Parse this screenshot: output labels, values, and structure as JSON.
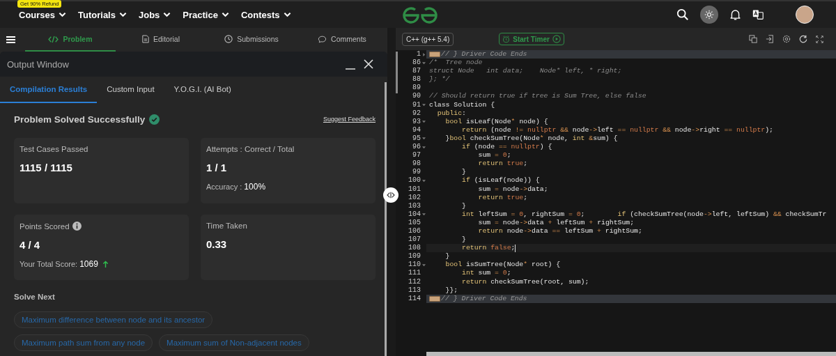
{
  "nav": {
    "items": [
      {
        "label": "Courses",
        "badge": "Get 90% Refund"
      },
      {
        "label": "Tutorials"
      },
      {
        "label": "Jobs"
      },
      {
        "label": "Practice"
      },
      {
        "label": "Contests"
      }
    ]
  },
  "problem_tabs": [
    {
      "label": "Problem",
      "selected": true
    },
    {
      "label": "Editorial",
      "selected": false
    },
    {
      "label": "Submissions",
      "selected": false
    },
    {
      "label": "Comments",
      "selected": false
    }
  ],
  "output_window": {
    "title": "Output Window",
    "tabs": [
      {
        "label": "Compilation Results",
        "selected": true
      },
      {
        "label": "Custom Input",
        "selected": false
      },
      {
        "label": "Y.O.G.I. (AI Bot)",
        "selected": false
      }
    ],
    "result_title": "Problem Solved Successfully",
    "feedback_link": "Suggest Feedback",
    "cards": [
      {
        "label": "Test Cases Passed",
        "value": "1115 / 1115",
        "info": false
      },
      {
        "label": "Attempts : Correct / Total",
        "value": "1 / 1",
        "sub_label": "Accuracy :",
        "sub_value": "100%",
        "info": false
      },
      {
        "label": "Points Scored",
        "value": "4 / 4",
        "sub_label": "Your Total Score:",
        "sub_value": "1069",
        "trend_up": true,
        "info": true
      },
      {
        "label": "Time Taken",
        "value": "0.33",
        "info": false
      }
    ],
    "solve_next": {
      "title": "Solve Next",
      "items": [
        "Maximum difference between node and its ancestor",
        "Maximum path sum from any node",
        "Maximum sum of Non-adjacent nodes"
      ]
    }
  },
  "editor": {
    "language": "C++ (g++ 5.4)",
    "timer_button": "Start Timer",
    "lines": [
      {
        "number": "1",
        "foldable": true,
        "collapsed": true,
        "folded_marker": true,
        "highlighted": true,
        "active": false,
        "segments": [
          {
            "kind": "comment",
            "text": "// } Driver Code Ends"
          }
        ]
      },
      {
        "number": "86",
        "foldable": true,
        "collapsed": false,
        "folded_marker": false,
        "highlighted": false,
        "active": false,
        "segments": [
          {
            "kind": "comment",
            "text": "/*  Tree node"
          }
        ]
      },
      {
        "number": "87",
        "foldable": false,
        "collapsed": false,
        "folded_marker": false,
        "highlighted": false,
        "active": false,
        "segments": [
          {
            "kind": "comment",
            "text": "struct Node   int data;    Node* left, * right;"
          }
        ]
      },
      {
        "number": "88",
        "foldable": false,
        "collapsed": false,
        "folded_marker": false,
        "highlighted": false,
        "active": false,
        "segments": [
          {
            "kind": "comment",
            "text": "}; */"
          }
        ]
      },
      {
        "number": "89",
        "foldable": false,
        "collapsed": false,
        "folded_marker": false,
        "highlighted": false,
        "active": false
      },
      {
        "number": "90",
        "foldable": false,
        "collapsed": false,
        "folded_marker": false,
        "highlighted": false,
        "active": false,
        "segments": [
          {
            "kind": "comment",
            "text": "// Should return true if tree is Sum Tree, else false"
          }
        ]
      },
      {
        "number": "91",
        "foldable": true,
        "collapsed": false,
        "folded_marker": false,
        "highlighted": false,
        "active": false,
        "segments": [
          {
            "kind": "plain",
            "text": "class Solution {"
          }
        ]
      },
      {
        "number": "92",
        "foldable": false,
        "collapsed": false,
        "folded_marker": false,
        "highlighted": false,
        "active": false,
        "segments": [
          {
            "kind": "keyword",
            "text": "  public"
          },
          {
            "kind": "plain",
            "text": ":"
          }
        ]
      },
      {
        "number": "93",
        "foldable": true,
        "collapsed": false,
        "folded_marker": false,
        "highlighted": false,
        "active": false,
        "segments": [
          {
            "kind": "keyword",
            "text": "    bool"
          },
          {
            "kind": "plain",
            "text": " isLeaf(Node"
          },
          {
            "kind": "operator",
            "text": "*"
          },
          {
            "kind": "plain",
            "text": " node) {"
          }
        ]
      },
      {
        "number": "94",
        "foldable": false,
        "collapsed": false,
        "folded_marker": false,
        "highlighted": false,
        "active": false,
        "segments": [
          {
            "kind": "keyword",
            "text": "        return"
          },
          {
            "kind": "plain",
            "text": " (node "
          },
          {
            "kind": "operator",
            "text": "!="
          },
          {
            "kind": "literal",
            "text": " nullptr"
          },
          {
            "kind": "operator",
            "text": " &&"
          },
          {
            "kind": "plain",
            "text": " node"
          },
          {
            "kind": "operator",
            "text": "->"
          },
          {
            "kind": "plain",
            "text": "left "
          },
          {
            "kind": "operator",
            "text": "=="
          },
          {
            "kind": "literal",
            "text": " nullptr"
          },
          {
            "kind": "operator",
            "text": " &&"
          },
          {
            "kind": "plain",
            "text": " node"
          },
          {
            "kind": "operator",
            "text": "->"
          },
          {
            "kind": "plain",
            "text": "right "
          },
          {
            "kind": "operator",
            "text": "=="
          },
          {
            "kind": "literal",
            "text": " nullptr"
          },
          {
            "kind": "plain",
            "text": ");"
          }
        ]
      },
      {
        "number": "95",
        "foldable": true,
        "collapsed": false,
        "folded_marker": false,
        "highlighted": false,
        "active": false,
        "segments": [
          {
            "kind": "plain",
            "text": "    }"
          },
          {
            "kind": "keyword",
            "text": "bool"
          },
          {
            "kind": "plain",
            "text": " checkSumTree(Node"
          },
          {
            "kind": "operator",
            "text": "*"
          },
          {
            "kind": "plain",
            "text": " node, "
          },
          {
            "kind": "keyword",
            "text": "int"
          },
          {
            "kind": "operator",
            "text": " &"
          },
          {
            "kind": "plain",
            "text": "sum) {"
          }
        ]
      },
      {
        "number": "96",
        "foldable": true,
        "collapsed": false,
        "folded_marker": false,
        "highlighted": false,
        "active": false,
        "segments": [
          {
            "kind": "keyword",
            "text": "        if"
          },
          {
            "kind": "plain",
            "text": " (node "
          },
          {
            "kind": "operator",
            "text": "=="
          },
          {
            "kind": "literal",
            "text": " nullptr"
          },
          {
            "kind": "plain",
            "text": ") {"
          }
        ]
      },
      {
        "number": "97",
        "foldable": false,
        "collapsed": false,
        "folded_marker": false,
        "highlighted": false,
        "active": false,
        "segments": [
          {
            "kind": "plain",
            "text": "            sum "
          },
          {
            "kind": "operator",
            "text": "="
          },
          {
            "kind": "literal",
            "text": " 0"
          },
          {
            "kind": "plain",
            "text": ";"
          }
        ]
      },
      {
        "number": "98",
        "foldable": false,
        "collapsed": false,
        "folded_marker": false,
        "highlighted": false,
        "active": false,
        "segments": [
          {
            "kind": "keyword",
            "text": "            return"
          },
          {
            "kind": "literal",
            "text": " true"
          },
          {
            "kind": "plain",
            "text": ";"
          }
        ]
      },
      {
        "number": "99",
        "foldable": false,
        "collapsed": false,
        "folded_marker": false,
        "highlighted": false,
        "active": false,
        "segments": [
          {
            "kind": "plain",
            "text": "        }"
          }
        ]
      },
      {
        "number": "100",
        "foldable": true,
        "collapsed": false,
        "folded_marker": false,
        "highlighted": false,
        "active": false,
        "segments": [
          {
            "kind": "keyword",
            "text": "        if"
          },
          {
            "kind": "plain",
            "text": " (isLeaf(node)) {"
          }
        ]
      },
      {
        "number": "101",
        "foldable": false,
        "collapsed": false,
        "folded_marker": false,
        "highlighted": false,
        "active": false,
        "segments": [
          {
            "kind": "plain",
            "text": "            sum "
          },
          {
            "kind": "operator",
            "text": "="
          },
          {
            "kind": "plain",
            "text": " node"
          },
          {
            "kind": "operator",
            "text": "->"
          },
          {
            "kind": "plain",
            "text": "data;"
          }
        ]
      },
      {
        "number": "102",
        "foldable": false,
        "collapsed": false,
        "folded_marker": false,
        "highlighted": false,
        "active": false,
        "segments": [
          {
            "kind": "keyword",
            "text": "            return"
          },
          {
            "kind": "literal",
            "text": " true"
          },
          {
            "kind": "plain",
            "text": ";"
          }
        ]
      },
      {
        "number": "103",
        "foldable": false,
        "collapsed": false,
        "folded_marker": false,
        "highlighted": false,
        "active": false,
        "segments": [
          {
            "kind": "plain",
            "text": "        }"
          }
        ]
      },
      {
        "number": "104",
        "foldable": true,
        "collapsed": false,
        "folded_marker": false,
        "highlighted": false,
        "active": false,
        "segments": [
          {
            "kind": "keyword",
            "text": "        int"
          },
          {
            "kind": "plain",
            "text": " leftSum "
          },
          {
            "kind": "operator",
            "text": "="
          },
          {
            "kind": "literal",
            "text": " 0"
          },
          {
            "kind": "plain",
            "text": ", rightSum "
          },
          {
            "kind": "operator",
            "text": "="
          },
          {
            "kind": "literal",
            "text": " 0"
          },
          {
            "kind": "plain",
            "text": ";"
          },
          {
            "kind": "keyword",
            "text": "        if"
          },
          {
            "kind": "plain",
            "text": " (checkSumTree(node"
          },
          {
            "kind": "operator",
            "text": "->"
          },
          {
            "kind": "plain",
            "text": "left, leftSum) "
          },
          {
            "kind": "operator",
            "text": "&&"
          },
          {
            "kind": "plain",
            "text": " checkSumTr"
          }
        ]
      },
      {
        "number": "105",
        "foldable": false,
        "collapsed": false,
        "folded_marker": false,
        "highlighted": false,
        "active": false,
        "segments": [
          {
            "kind": "plain",
            "text": "            sum "
          },
          {
            "kind": "operator",
            "text": "="
          },
          {
            "kind": "plain",
            "text": " node"
          },
          {
            "kind": "operator",
            "text": "->"
          },
          {
            "kind": "plain",
            "text": "data "
          },
          {
            "kind": "operator",
            "text": "+"
          },
          {
            "kind": "plain",
            "text": " leftSum "
          },
          {
            "kind": "operator",
            "text": "+"
          },
          {
            "kind": "plain",
            "text": " rightSum;"
          }
        ]
      },
      {
        "number": "106",
        "foldable": false,
        "collapsed": false,
        "folded_marker": false,
        "highlighted": false,
        "active": false,
        "segments": [
          {
            "kind": "keyword",
            "text": "            return"
          },
          {
            "kind": "plain",
            "text": " node"
          },
          {
            "kind": "operator",
            "text": "->"
          },
          {
            "kind": "plain",
            "text": "data "
          },
          {
            "kind": "operator",
            "text": "=="
          },
          {
            "kind": "plain",
            "text": " leftSum "
          },
          {
            "kind": "operator",
            "text": "+"
          },
          {
            "kind": "plain",
            "text": " rightSum;"
          }
        ]
      },
      {
        "number": "107",
        "foldable": false,
        "collapsed": false,
        "folded_marker": false,
        "highlighted": false,
        "active": false,
        "segments": [
          {
            "kind": "plain",
            "text": "        }"
          }
        ]
      },
      {
        "number": "108",
        "foldable": false,
        "collapsed": false,
        "folded_marker": false,
        "highlighted": false,
        "active": true,
        "segments": [
          {
            "kind": "keyword",
            "text": "        return"
          },
          {
            "kind": "literal",
            "text": " false"
          },
          {
            "kind": "plain",
            "text": ";"
          }
        ]
      },
      {
        "number": "109",
        "foldable": false,
        "collapsed": false,
        "folded_marker": false,
        "highlighted": false,
        "active": false,
        "segments": [
          {
            "kind": "plain",
            "text": "    }"
          }
        ]
      },
      {
        "number": "110",
        "foldable": true,
        "collapsed": false,
        "folded_marker": false,
        "highlighted": false,
        "active": false,
        "segments": [
          {
            "kind": "keyword",
            "text": "    bool"
          },
          {
            "kind": "plain",
            "text": " isSumTree(Node"
          },
          {
            "kind": "operator",
            "text": "*"
          },
          {
            "kind": "plain",
            "text": " root) {"
          }
        ]
      },
      {
        "number": "111",
        "foldable": false,
        "collapsed": false,
        "folded_marker": false,
        "highlighted": false,
        "active": false,
        "segments": [
          {
            "kind": "keyword",
            "text": "        int"
          },
          {
            "kind": "plain",
            "text": " sum "
          },
          {
            "kind": "operator",
            "text": "="
          },
          {
            "kind": "literal",
            "text": " 0"
          },
          {
            "kind": "plain",
            "text": ";"
          }
        ]
      },
      {
        "number": "112",
        "foldable": false,
        "collapsed": false,
        "folded_marker": false,
        "highlighted": false,
        "active": false,
        "segments": [
          {
            "kind": "keyword",
            "text": "        return"
          },
          {
            "kind": "plain",
            "text": " checkSumTree(root, sum);"
          }
        ]
      },
      {
        "number": "113",
        "foldable": false,
        "collapsed": false,
        "folded_marker": false,
        "highlighted": false,
        "active": false,
        "segments": [
          {
            "kind": "plain",
            "text": "    }};"
          }
        ]
      },
      {
        "number": "114",
        "foldable": false,
        "collapsed": false,
        "folded_marker": true,
        "highlighted": true,
        "active": false,
        "segments": [
          {
            "kind": "comment",
            "text": "// } Driver Code Ends"
          }
        ]
      }
    ]
  }
}
